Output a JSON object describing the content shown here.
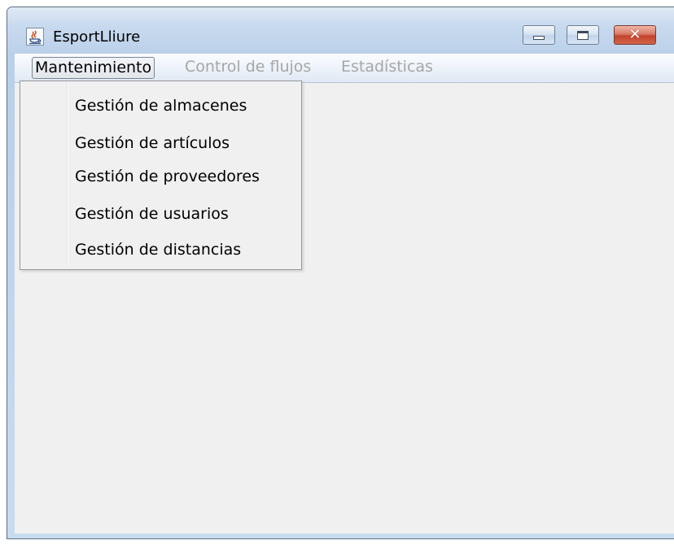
{
  "window": {
    "title": "EsportLliure",
    "app_icon": "java-cup-icon",
    "controls": {
      "minimize_icon": "minimize-icon",
      "maximize_icon": "maximize-icon",
      "close_icon": "close-icon",
      "close_glyph": "✕"
    },
    "close_color": "#c2432b"
  },
  "menubar": {
    "items": [
      {
        "label": "Mantenimiento",
        "state": "open"
      },
      {
        "label": "Control de flujos",
        "state": "disabled"
      },
      {
        "label": "Estadísticas",
        "state": "disabled"
      }
    ]
  },
  "dropdown": {
    "items": [
      {
        "label": "Gestión de almacenes"
      },
      {
        "label": "Gestión de artículos"
      },
      {
        "label": "Gestión de proveedores"
      },
      {
        "label": "Gestión de usuarios"
      },
      {
        "label": "Gestión de distancias"
      }
    ]
  },
  "colors": {
    "content_background": "#f0f0f0",
    "disabled_text": "#a6a6a6"
  }
}
